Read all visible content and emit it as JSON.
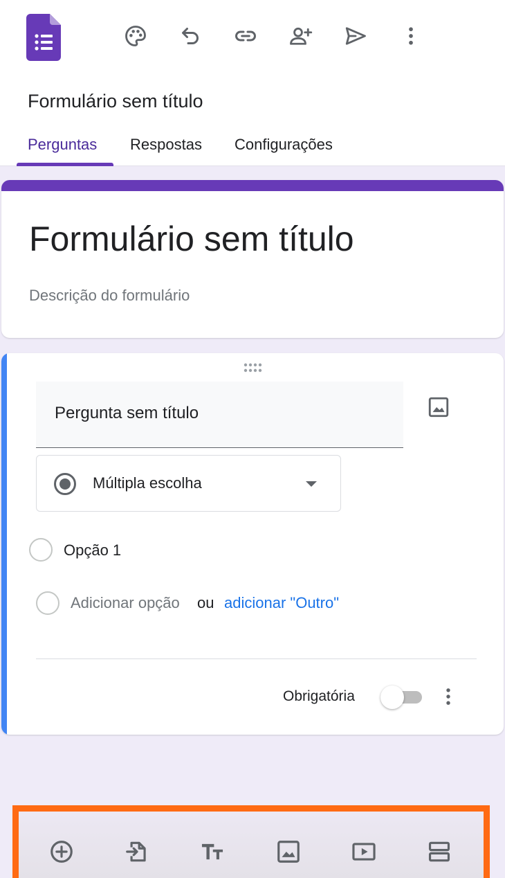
{
  "header": {
    "form_name": "Formulário sem título",
    "toolbar_icons": [
      "palette-icon",
      "undo-icon",
      "link-icon",
      "add-person-icon",
      "send-icon",
      "more-vert-icon"
    ]
  },
  "tabs": [
    {
      "label": "Perguntas",
      "active": true
    },
    {
      "label": "Respostas",
      "active": false
    },
    {
      "label": "Configurações",
      "active": false
    }
  ],
  "title_card": {
    "title": "Formulário sem título",
    "description_placeholder": "Descrição do formulário"
  },
  "question": {
    "title": "Pergunta sem título",
    "type": "Múltipla escolha",
    "options": [
      "Opção 1"
    ],
    "add_option": "Adicionar opção",
    "or": "ou",
    "add_other": "adicionar \"Outro\"",
    "required_label": "Obrigatória",
    "required": false
  },
  "bottom_toolbar": {
    "icons": [
      "add-question-icon",
      "import-questions-icon",
      "add-title-icon",
      "add-image-icon",
      "add-video-icon",
      "add-section-icon"
    ]
  },
  "colors": {
    "brand_purple": "#673ab7",
    "accent_blue": "#4285f4",
    "link_blue": "#1a73e8",
    "highlight_orange": "#ff6a13",
    "icon_gray": "#5f6368"
  }
}
